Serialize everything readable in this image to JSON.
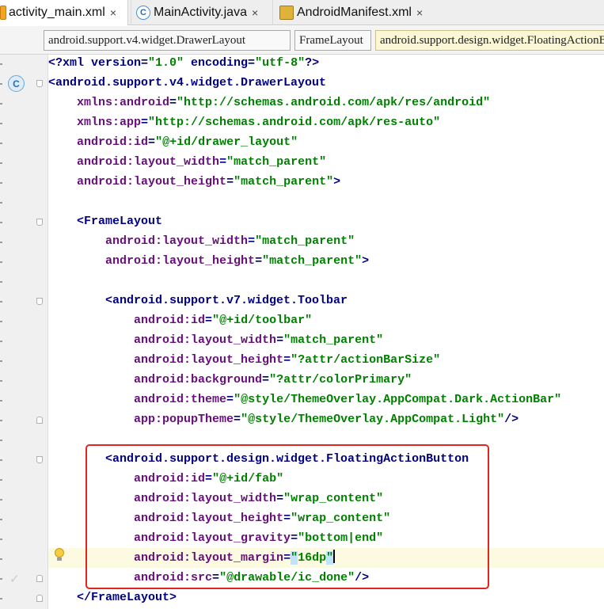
{
  "tabs": [
    {
      "label": "activity_main.xml",
      "icon": "xml-file-icon",
      "active": true
    },
    {
      "label": "MainActivity.java",
      "icon": "java-class-icon",
      "active": false
    },
    {
      "label": "AndroidManifest.xml",
      "icon": "manifest-file-icon",
      "active": false
    }
  ],
  "close_glyph": "×",
  "breadcrumbs": [
    "android.support.v4.widget.DrawerLayout",
    "FrameLayout",
    "android.support.design.widget.FloatingActionButton"
  ],
  "class_gutter_icon": "C",
  "colors": {
    "tag": "#000080",
    "attr_name": "#660e7a",
    "value": "#008000",
    "prolog": "#000080",
    "highlight_box": "#e2261f"
  },
  "code_lines": [
    [
      {
        "t": "<?xml version=",
        "c": "prolog"
      },
      {
        "t": "\"1.0\"",
        "c": "value"
      },
      {
        "t": " encoding=",
        "c": "prolog"
      },
      {
        "t": "\"utf-8\"",
        "c": "value"
      },
      {
        "t": "?>",
        "c": "prolog"
      }
    ],
    [
      {
        "t": "<android.support.v4.widget.DrawerLayout",
        "c": "tag"
      }
    ],
    [
      {
        "t": "    xmlns:",
        "c": "attr"
      },
      {
        "t": "android",
        "c": "attr"
      },
      {
        "t": "=",
        "c": "tag"
      },
      {
        "t": "\"http://schemas.android.com/apk/res/android\"",
        "c": "value"
      }
    ],
    [
      {
        "t": "    xmlns:",
        "c": "attr"
      },
      {
        "t": "app",
        "c": "attr"
      },
      {
        "t": "=",
        "c": "tag"
      },
      {
        "t": "\"http://schemas.android.com/apk/res-auto\"",
        "c": "value"
      }
    ],
    [
      {
        "t": "    android:",
        "c": "attr"
      },
      {
        "t": "id",
        "c": "attr"
      },
      {
        "t": "=",
        "c": "tag"
      },
      {
        "t": "\"@+id/drawer_layout\"",
        "c": "value"
      }
    ],
    [
      {
        "t": "    android:",
        "c": "attr"
      },
      {
        "t": "layout_width",
        "c": "attr"
      },
      {
        "t": "=",
        "c": "tag"
      },
      {
        "t": "\"match_parent\"",
        "c": "value"
      }
    ],
    [
      {
        "t": "    android:",
        "c": "attr"
      },
      {
        "t": "layout_height",
        "c": "attr"
      },
      {
        "t": "=",
        "c": "tag"
      },
      {
        "t": "\"match_parent\"",
        "c": "value"
      },
      {
        "t": ">",
        "c": "tag"
      }
    ],
    [],
    [
      {
        "t": "    <FrameLayout",
        "c": "tag"
      }
    ],
    [
      {
        "t": "        android:",
        "c": "attr"
      },
      {
        "t": "layout_width",
        "c": "attr"
      },
      {
        "t": "=",
        "c": "tag"
      },
      {
        "t": "\"match_parent\"",
        "c": "value"
      }
    ],
    [
      {
        "t": "        android:",
        "c": "attr"
      },
      {
        "t": "layout_height",
        "c": "attr"
      },
      {
        "t": "=",
        "c": "tag"
      },
      {
        "t": "\"match_parent\"",
        "c": "value"
      },
      {
        "t": ">",
        "c": "tag"
      }
    ],
    [],
    [
      {
        "t": "        <android.support.v7.widget.Toolbar",
        "c": "tag"
      }
    ],
    [
      {
        "t": "            android:",
        "c": "attr"
      },
      {
        "t": "id",
        "c": "attr"
      },
      {
        "t": "=",
        "c": "tag"
      },
      {
        "t": "\"@+id/toolbar\"",
        "c": "value"
      }
    ],
    [
      {
        "t": "            android:",
        "c": "attr"
      },
      {
        "t": "layout_width",
        "c": "attr"
      },
      {
        "t": "=",
        "c": "tag"
      },
      {
        "t": "\"match_parent\"",
        "c": "value"
      }
    ],
    [
      {
        "t": "            android:",
        "c": "attr"
      },
      {
        "t": "layout_height",
        "c": "attr"
      },
      {
        "t": "=",
        "c": "tag"
      },
      {
        "t": "\"?attr/actionBarSize\"",
        "c": "value"
      }
    ],
    [
      {
        "t": "            android:",
        "c": "attr"
      },
      {
        "t": "background",
        "c": "attr"
      },
      {
        "t": "=",
        "c": "tag"
      },
      {
        "t": "\"?attr/colorPrimary\"",
        "c": "value"
      }
    ],
    [
      {
        "t": "            android:",
        "c": "attr"
      },
      {
        "t": "theme",
        "c": "attr"
      },
      {
        "t": "=",
        "c": "tag"
      },
      {
        "t": "\"@style/ThemeOverlay.AppCompat.Dark.ActionBar\"",
        "c": "value"
      }
    ],
    [
      {
        "t": "            app:",
        "c": "attr"
      },
      {
        "t": "popupTheme",
        "c": "attr"
      },
      {
        "t": "=",
        "c": "tag"
      },
      {
        "t": "\"@style/ThemeOverlay.AppCompat.Light\"",
        "c": "value"
      },
      {
        "t": "/>",
        "c": "tag"
      }
    ],
    [],
    [
      {
        "t": "        <android.support.design.widget.FloatingActionButton",
        "c": "tag"
      }
    ],
    [
      {
        "t": "            android:",
        "c": "attr"
      },
      {
        "t": "id",
        "c": "attr"
      },
      {
        "t": "=",
        "c": "tag"
      },
      {
        "t": "\"@+id/fab\"",
        "c": "value"
      }
    ],
    [
      {
        "t": "            android:",
        "c": "attr"
      },
      {
        "t": "layout_width",
        "c": "attr"
      },
      {
        "t": "=",
        "c": "tag"
      },
      {
        "t": "\"wrap_content\"",
        "c": "value"
      }
    ],
    [
      {
        "t": "            android:",
        "c": "attr"
      },
      {
        "t": "layout_height",
        "c": "attr"
      },
      {
        "t": "=",
        "c": "tag"
      },
      {
        "t": "\"wrap_content\"",
        "c": "value"
      }
    ],
    [
      {
        "t": "            android:",
        "c": "attr"
      },
      {
        "t": "layout_gravity",
        "c": "attr"
      },
      {
        "t": "=",
        "c": "tag"
      },
      {
        "t": "\"bottom|end\"",
        "c": "value"
      }
    ],
    [
      {
        "t": "            android:",
        "c": "attr"
      },
      {
        "t": "layout_margin",
        "c": "attr"
      },
      {
        "t": "=",
        "c": "tag"
      },
      {
        "t": "\"",
        "c": "value-sel"
      },
      {
        "t": "16dp",
        "c": "value"
      },
      {
        "t": "\"",
        "c": "value-sel"
      },
      {
        "t": "",
        "c": "cursor"
      }
    ],
    [
      {
        "t": "            android:",
        "c": "attr"
      },
      {
        "t": "src",
        "c": "attr"
      },
      {
        "t": "=",
        "c": "tag"
      },
      {
        "t": "\"@drawable/ic_done\"",
        "c": "value"
      },
      {
        "t": "/>",
        "c": "tag"
      }
    ],
    [
      {
        "t": "    </FrameLayout>",
        "c": "tag"
      }
    ]
  ]
}
